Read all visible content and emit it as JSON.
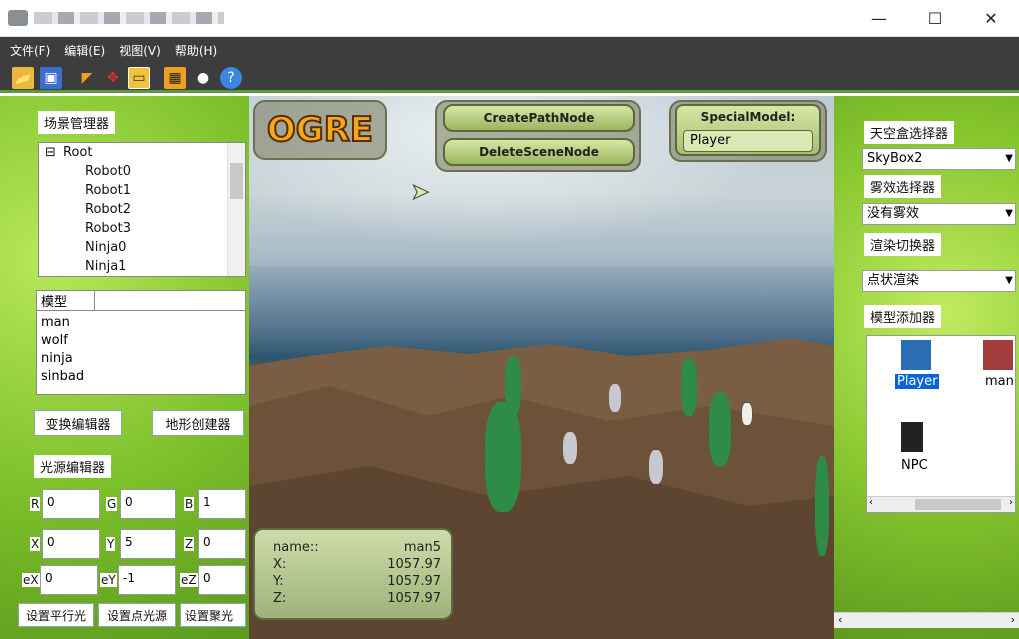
{
  "window": {
    "minimize": "—",
    "maximize": "☐",
    "close": "✕"
  },
  "menu": [
    "文件(F)",
    "编辑(E)",
    "视图(V)",
    "帮助(H)"
  ],
  "toolbar": {
    "icons": [
      "open-folder-icon",
      "save-icon",
      "select-arrow-icon",
      "move-icon",
      "window-icon",
      "grid-icon",
      "bug-icon",
      "help-icon"
    ]
  },
  "left": {
    "scene_manager": "场景管理器",
    "tree": {
      "root": "Root",
      "toggle": "⊟",
      "children": [
        "Robot0",
        "Robot1",
        "Robot2",
        "Robot3",
        "Ninja0",
        "Ninja1"
      ]
    },
    "model_header": "模型",
    "models": [
      "man",
      "wolf",
      "ninja",
      "sinbad"
    ],
    "transform_btn": "变换编辑器",
    "terrain_btn": "地形创建器",
    "light_editor": "光源编辑器",
    "fields": {
      "R": {
        "label": "R",
        "value": "0"
      },
      "G": {
        "label": "G",
        "value": "0"
      },
      "B": {
        "label": "B",
        "value": "1"
      },
      "X": {
        "label": "X",
        "value": "0"
      },
      "Y": {
        "label": "Y",
        "value": "5"
      },
      "Z": {
        "label": "Z",
        "value": "0"
      },
      "eX": {
        "label": "eX",
        "value": "0"
      },
      "eY": {
        "label": "eY",
        "value": "-1"
      },
      "eZ": {
        "label": "eZ",
        "value": "0"
      }
    },
    "btn_parallel": "设置平行光",
    "btn_point": "设置点光源",
    "btn_spot": "设置聚光"
  },
  "viewport": {
    "logo": "OGRE",
    "create_path": "CreatePathNode",
    "delete_node": "DeleteSceneNode",
    "special_label": "SpecialModel:",
    "special_value": "Player",
    "info": {
      "name_label": "name::",
      "name_value": "man5",
      "x_label": "X:",
      "x_value": "1057.97",
      "y_label": "Y:",
      "y_value": "1057.97",
      "z_label": "Z:",
      "z_value": "1057.97"
    }
  },
  "right": {
    "skybox_title": "天空盒选择器",
    "skybox_value": "SkyBox2",
    "fog_title": "雾效选择器",
    "fog_value": "没有雾效",
    "render_title": "渲染切换器",
    "render_value": "点状渲染",
    "model_adder": "模型添加器",
    "items": [
      {
        "label": "Player"
      },
      {
        "label": "man"
      },
      {
        "label": "NPC"
      }
    ]
  },
  "colors": {
    "accent_green": "#7cc02a",
    "menu_bg": "#3d3d3d",
    "selection": "#0a64d6"
  }
}
